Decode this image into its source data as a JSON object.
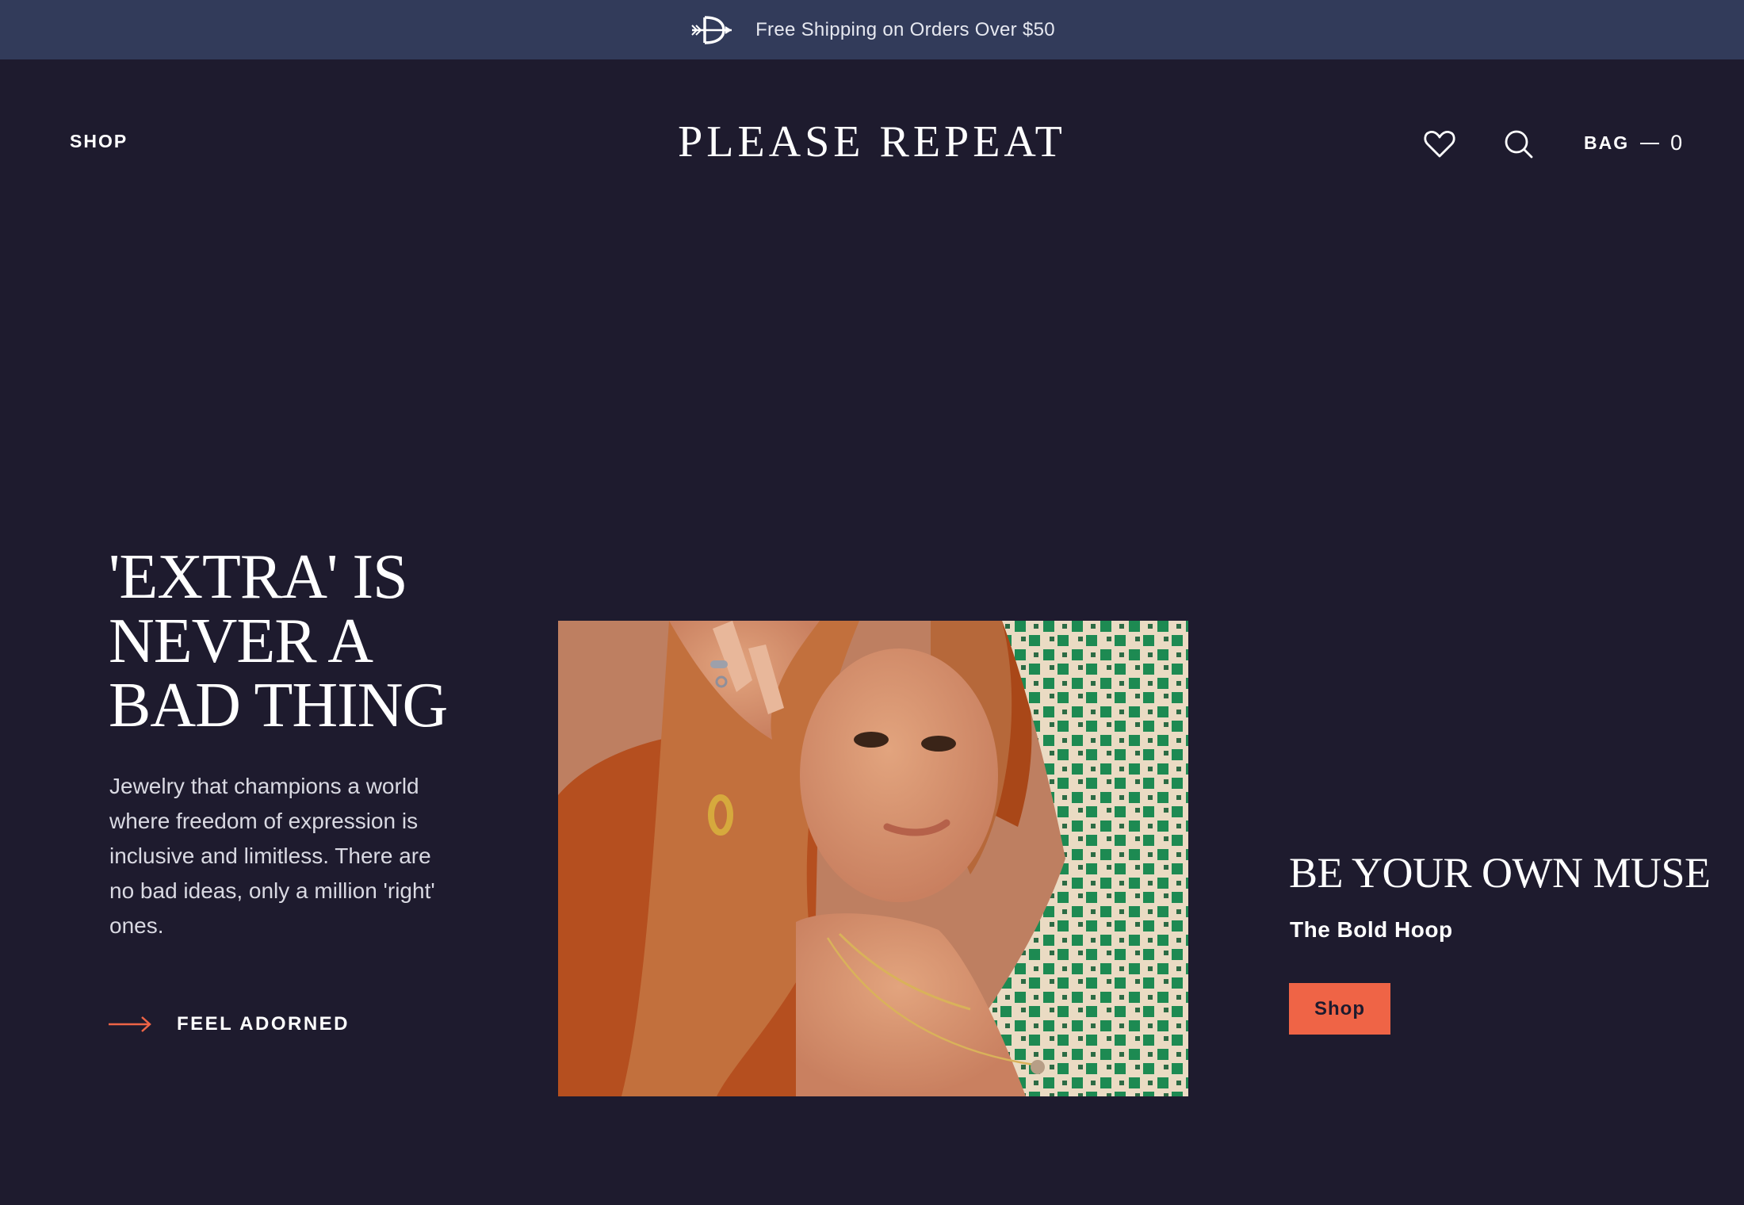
{
  "announcement": {
    "text": "Free Shipping on Orders Over $50",
    "icon": "arrow-logo-icon"
  },
  "header": {
    "nav_shop": "SHOP",
    "brand": "PLEASE REPEAT",
    "wishlist_icon": "heart-icon",
    "search_icon": "search-icon",
    "bag_label": "BAG",
    "bag_count": "0"
  },
  "hero": {
    "title_lines": [
      "'EXTRA' IS",
      "NEVER A",
      "BAD THING"
    ],
    "description": "Jewelry that champions a world where freedom of expression is inclusive and limitless. There are no bad ideas, only a million 'right' ones.",
    "cta_label": "FEEL ADORNED",
    "cta_icon": "arrow-right-icon"
  },
  "feature": {
    "title": "BE YOUR OWN MUSE",
    "subtitle": "The Bold Hoop",
    "button_label": "Shop"
  },
  "colors": {
    "background": "#1e1b2e",
    "announcement_bar": "#323b5a",
    "accent": "#ef6446",
    "text": "#ffffff"
  }
}
